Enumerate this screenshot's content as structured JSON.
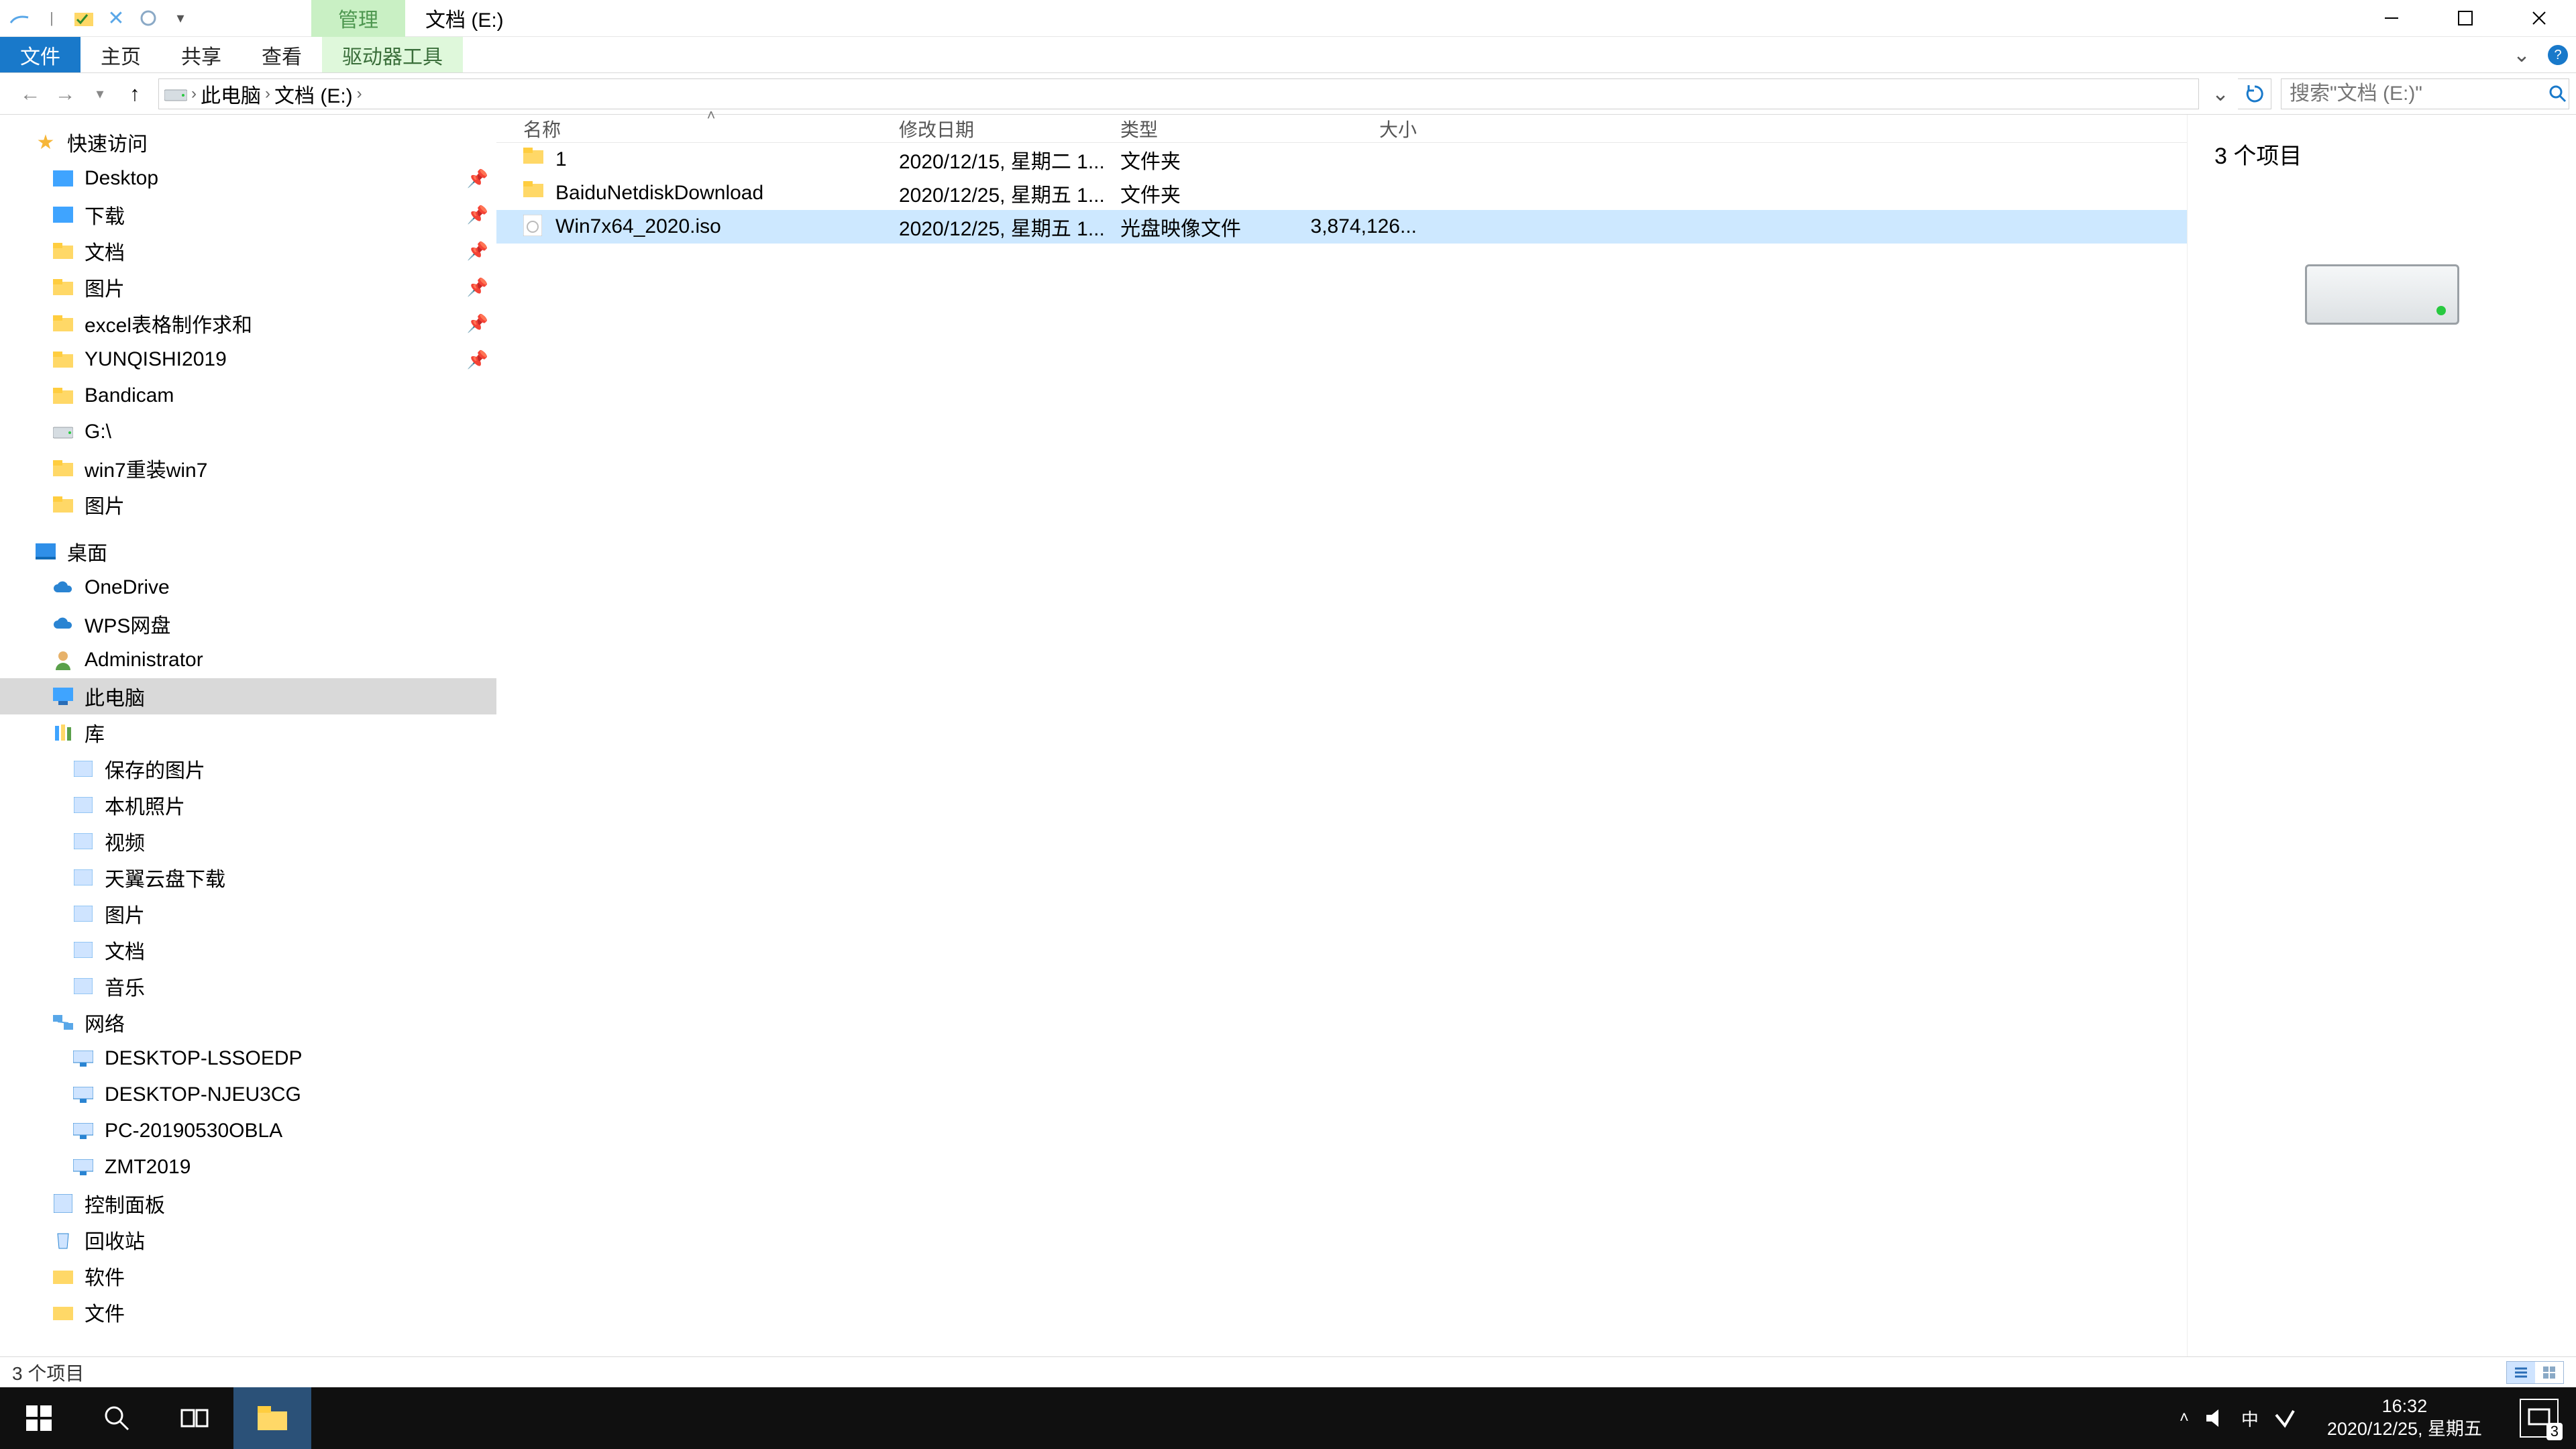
{
  "titlebar": {
    "contextual_tab": "管理",
    "window_title": "文档 (E:)"
  },
  "ribbon": {
    "file": "文件",
    "home": "主页",
    "share": "共享",
    "view": "查看",
    "drive_tools": "驱动器工具"
  },
  "breadcrumbs": {
    "root": "此电脑",
    "drive": "文档 (E:)"
  },
  "search": {
    "placeholder": "搜索\"文档 (E:)\""
  },
  "columns": {
    "name": "名称",
    "date": "修改日期",
    "type": "类型",
    "size": "大小"
  },
  "files": [
    {
      "name": "1",
      "date": "2020/12/15, 星期二 1...",
      "type": "文件夹",
      "size": "",
      "icon": "folder",
      "selected": false
    },
    {
      "name": "BaiduNetdiskDownload",
      "date": "2020/12/25, 星期五 1...",
      "type": "文件夹",
      "size": "",
      "icon": "folder",
      "selected": false
    },
    {
      "name": "Win7x64_2020.iso",
      "date": "2020/12/25, 星期五 1...",
      "type": "光盘映像文件",
      "size": "3,874,126...",
      "icon": "iso",
      "selected": true
    }
  ],
  "sidebar": {
    "quick_access": "快速访问",
    "quick_items": [
      {
        "label": "Desktop",
        "icon": "blue",
        "pin": true
      },
      {
        "label": "下载",
        "icon": "blue",
        "pin": true
      },
      {
        "label": "文档",
        "icon": "folder",
        "pin": true
      },
      {
        "label": "图片",
        "icon": "folder",
        "pin": true
      },
      {
        "label": "excel表格制作求和",
        "icon": "folder",
        "pin": true
      },
      {
        "label": "YUNQISHI2019",
        "icon": "folder",
        "pin": true
      },
      {
        "label": "Bandicam",
        "icon": "folder",
        "pin": false
      },
      {
        "label": "G:\\",
        "icon": "drive",
        "pin": false
      },
      {
        "label": "win7重装win7",
        "icon": "folder",
        "pin": false
      },
      {
        "label": "图片",
        "icon": "folder",
        "pin": false
      }
    ],
    "desktop": "桌面",
    "desktop_items": [
      {
        "label": "OneDrive",
        "icon": "onedrive"
      },
      {
        "label": "WPS网盘",
        "icon": "onedrive"
      },
      {
        "label": "Administrator",
        "icon": "user"
      },
      {
        "label": "此电脑",
        "icon": "pc",
        "selected": true
      },
      {
        "label": "库",
        "icon": "lib"
      }
    ],
    "lib_items": [
      {
        "label": "保存的图片"
      },
      {
        "label": "本机照片"
      },
      {
        "label": "视频"
      },
      {
        "label": "天翼云盘下载"
      },
      {
        "label": "图片"
      },
      {
        "label": "文档"
      },
      {
        "label": "音乐"
      }
    ],
    "network": "网络",
    "net_items": [
      {
        "label": "DESKTOP-LSSOEDP"
      },
      {
        "label": "DESKTOP-NJEU3CG"
      },
      {
        "label": "PC-20190530OBLA"
      },
      {
        "label": "ZMT2019"
      }
    ],
    "control_panel": "控制面板",
    "recycle": "回收站",
    "software": "软件",
    "documents": "文件"
  },
  "preview": {
    "title": "3 个项目"
  },
  "status": {
    "text": "3 个项目"
  },
  "tray": {
    "ime": "中",
    "time": "16:32",
    "date": "2020/12/25, 星期五",
    "notif_count": "3"
  }
}
